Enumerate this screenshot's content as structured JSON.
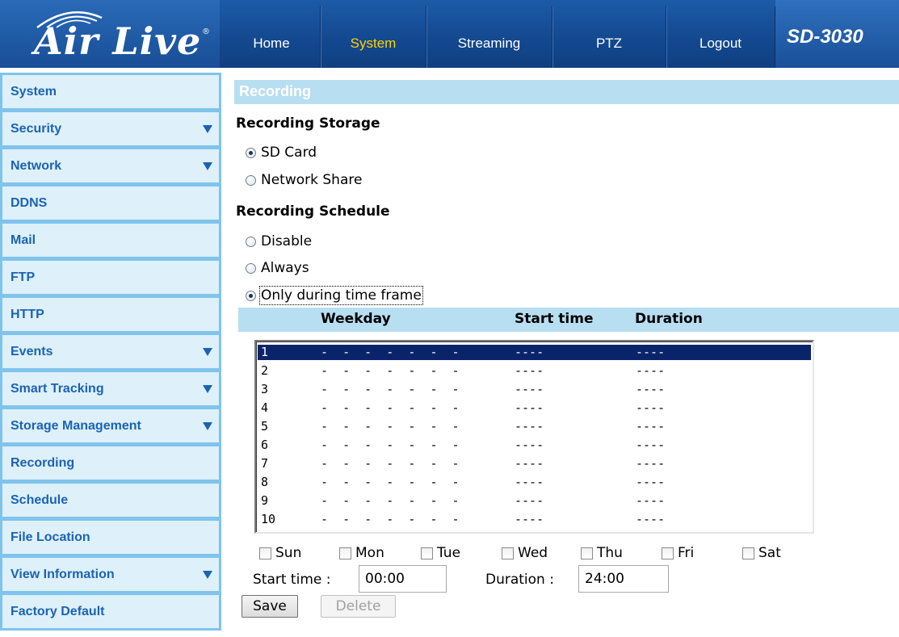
{
  "header": {
    "logo_text": "Air Live",
    "model": "SD-3030",
    "nav": [
      {
        "label": "Home"
      },
      {
        "label": "System"
      },
      {
        "label": "Streaming"
      },
      {
        "label": "PTZ"
      },
      {
        "label": "Logout"
      }
    ],
    "active_nav": "System"
  },
  "sidebar": {
    "items": [
      {
        "label": "System",
        "has_arrow": false
      },
      {
        "label": "Security",
        "has_arrow": true
      },
      {
        "label": "Network",
        "has_arrow": true
      },
      {
        "label": "DDNS",
        "has_arrow": false
      },
      {
        "label": "Mail",
        "has_arrow": false
      },
      {
        "label": "FTP",
        "has_arrow": false
      },
      {
        "label": "HTTP",
        "has_arrow": false
      },
      {
        "label": "Events",
        "has_arrow": true
      },
      {
        "label": "Smart Tracking",
        "has_arrow": true
      },
      {
        "label": "Storage Management",
        "has_arrow": true
      },
      {
        "label": "Recording",
        "has_arrow": false
      },
      {
        "label": "Schedule",
        "has_arrow": false
      },
      {
        "label": "File Location",
        "has_arrow": false
      },
      {
        "label": "View Information",
        "has_arrow": true
      },
      {
        "label": "Factory Default",
        "has_arrow": false
      }
    ]
  },
  "main": {
    "section_title": "Recording",
    "storage": {
      "heading": "Recording Storage",
      "options": [
        {
          "label": "SD Card",
          "checked": true
        },
        {
          "label": "Network Share",
          "checked": false
        }
      ]
    },
    "schedule": {
      "heading": "Recording Schedule",
      "options": [
        {
          "label": "Disable",
          "checked": false
        },
        {
          "label": "Always",
          "checked": false
        },
        {
          "label": "Only during time frame",
          "checked": true
        }
      ],
      "columns": {
        "weekday": "Weekday",
        "start_time": "Start time",
        "duration": "Duration"
      },
      "rows": [
        {
          "num": "1",
          "days": "-  -  -  -  -  -  -",
          "start": "----",
          "duration": "----"
        },
        {
          "num": "2",
          "days": "-  -  -  -  -  -  -",
          "start": "----",
          "duration": "----"
        },
        {
          "num": "3",
          "days": "-  -  -  -  -  -  -",
          "start": "----",
          "duration": "----"
        },
        {
          "num": "4",
          "days": "-  -  -  -  -  -  -",
          "start": "----",
          "duration": "----"
        },
        {
          "num": "5",
          "days": "-  -  -  -  -  -  -",
          "start": "----",
          "duration": "----"
        },
        {
          "num": "6",
          "days": "-  -  -  -  -  -  -",
          "start": "----",
          "duration": "----"
        },
        {
          "num": "7",
          "days": "-  -  -  -  -  -  -",
          "start": "----",
          "duration": "----"
        },
        {
          "num": "8",
          "days": "-  -  -  -  -  -  -",
          "start": "----",
          "duration": "----"
        },
        {
          "num": "9",
          "days": "-  -  -  -  -  -  -",
          "start": "----",
          "duration": "----"
        },
        {
          "num": "10",
          "days": "-  -  -  -  -  -  -",
          "start": "----",
          "duration": "----"
        }
      ],
      "selected_row": "1",
      "days": [
        {
          "label": "Sun",
          "checked": false
        },
        {
          "label": "Mon",
          "checked": false
        },
        {
          "label": "Tue",
          "checked": false
        },
        {
          "label": "Wed",
          "checked": false
        },
        {
          "label": "Thu",
          "checked": false
        },
        {
          "label": "Fri",
          "checked": false
        },
        {
          "label": "Sat",
          "checked": false
        }
      ],
      "start_time_label": "Start time :",
      "start_time_value": "00:00",
      "duration_label": "Duration :",
      "duration_value": "24:00"
    },
    "buttons": {
      "save": "Save",
      "delete": "Delete"
    }
  },
  "colors": {
    "header_blue": "#13488f",
    "active_nav": "#ffd200",
    "sidebar_bg": "#def0f9",
    "sidebar_border": "#7fc4ec",
    "sidebar_text": "#1a63b4",
    "section_bar": "#b8def2",
    "selected_row": "#0a246a"
  }
}
